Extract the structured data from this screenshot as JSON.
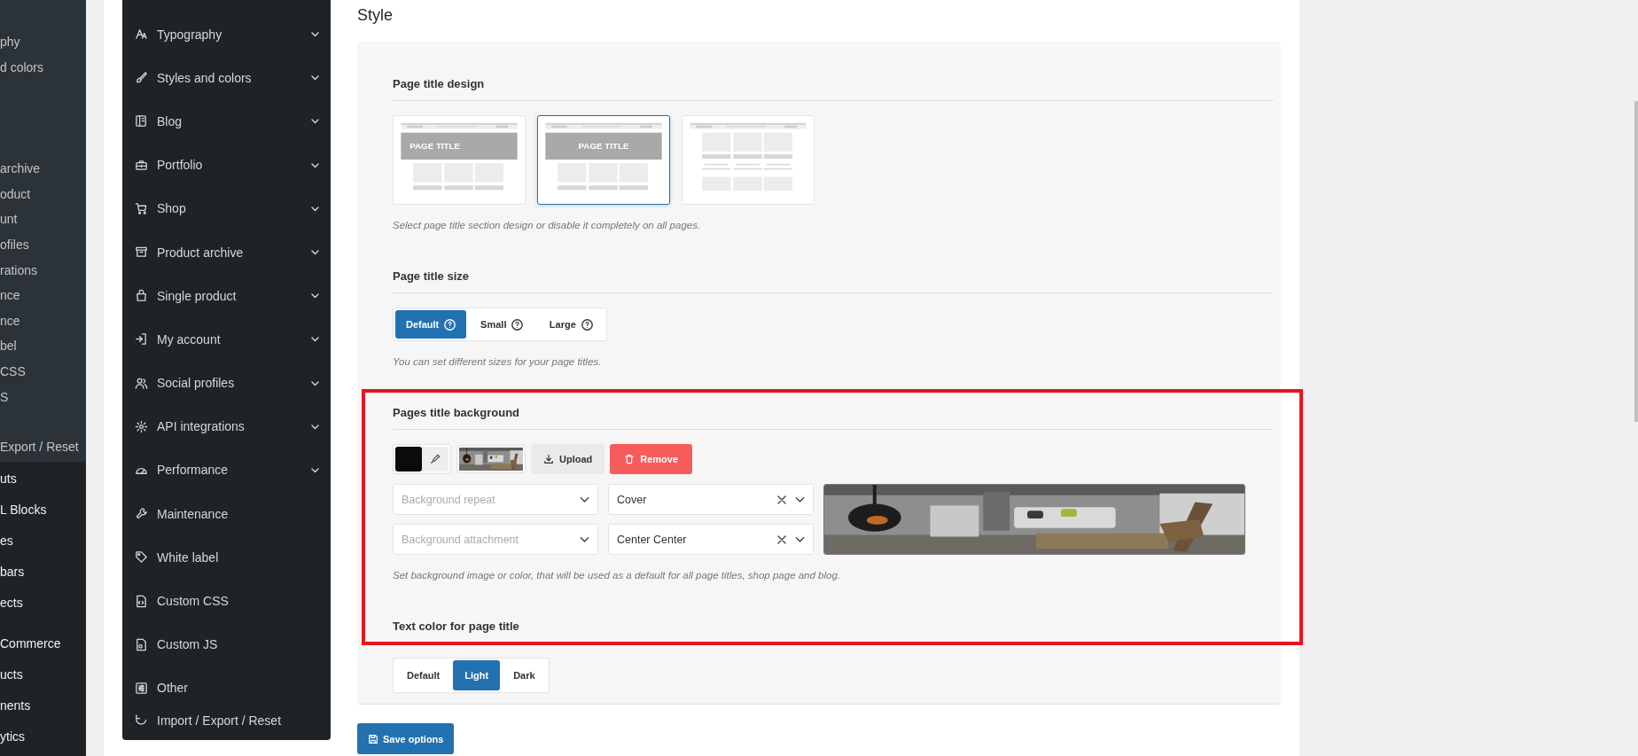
{
  "admin_menu": {
    "upper_items": [
      {
        "label": "phy"
      },
      {
        "label": "d colors"
      },
      {
        "label": "archive"
      },
      {
        "label": "oduct"
      },
      {
        "label": "unt"
      },
      {
        "label": "ofiles"
      },
      {
        "label": "rations"
      },
      {
        "label": "nce"
      },
      {
        "label": "nce"
      },
      {
        "label": "bel"
      },
      {
        "label": "CSS"
      },
      {
        "label": "S"
      },
      {
        "label": "Export / Reset"
      }
    ],
    "lower_items": [
      {
        "label": "uts"
      },
      {
        "label": "L Blocks"
      },
      {
        "label": "es"
      },
      {
        "label": "bars"
      },
      {
        "label": "ects"
      },
      {
        "label": "Commerce"
      },
      {
        "label": "ucts"
      },
      {
        "label": "nents"
      },
      {
        "label": "ytics"
      }
    ]
  },
  "options_menu": {
    "items": [
      {
        "label": "Typography",
        "expandable": true
      },
      {
        "label": "Styles and colors",
        "expandable": true
      },
      {
        "label": "Blog",
        "expandable": true
      },
      {
        "label": "Portfolio",
        "expandable": true
      },
      {
        "label": "Shop",
        "expandable": true
      },
      {
        "label": "Product archive",
        "expandable": true
      },
      {
        "label": "Single product",
        "expandable": true
      },
      {
        "label": "My account",
        "expandable": true
      },
      {
        "label": "Social profiles",
        "expandable": true
      },
      {
        "label": "API integrations",
        "expandable": true
      },
      {
        "label": "Performance",
        "expandable": true
      },
      {
        "label": "Maintenance",
        "expandable": false
      },
      {
        "label": "White label",
        "expandable": false
      },
      {
        "label": "Custom CSS",
        "expandable": false
      },
      {
        "label": "Custom JS",
        "expandable": false
      },
      {
        "label": "Other",
        "expandable": false
      },
      {
        "label": "Import / Export / Reset",
        "expandable": false
      }
    ]
  },
  "page": {
    "title": "Style",
    "sections": [
      {
        "kind": "thumbs",
        "heading": "Page title design",
        "hint": "Select page title section design or disable it completely on all pages.",
        "options": [
          {
            "kind": "left",
            "label": "PAGE TITLE",
            "selected": false
          },
          {
            "kind": "center",
            "label": "PAGE TITLE",
            "selected": true
          },
          {
            "kind": "none",
            "selected": false
          }
        ]
      },
      {
        "kind": "segmented",
        "heading": "Page title size",
        "hint": "You can set different sizes for your page titles.",
        "options": [
          {
            "label": "Default",
            "selected": true,
            "help": true
          },
          {
            "label": "Small",
            "selected": false,
            "help": true
          },
          {
            "label": "Large",
            "selected": false,
            "help": true
          }
        ]
      },
      {
        "kind": "background",
        "heading": "Pages title background",
        "hint": "Set background image or color, that will be used as a default for all page titles, shop page and blog.",
        "color": "#0b0b0b",
        "buttons": [
          {
            "kind": "upload",
            "label": "Upload"
          },
          {
            "kind": "remove",
            "label": "Remove"
          }
        ],
        "selects": [
          {
            "placeholder": "Background repeat"
          },
          {
            "value": "Cover",
            "clearable": true
          },
          {
            "placeholder": "Background attachment"
          },
          {
            "value": "Center Center",
            "clearable": true
          }
        ]
      },
      {
        "kind": "segmented",
        "heading": "Text color for page title",
        "options": [
          {
            "label": "Default",
            "selected": false,
            "help": false
          },
          {
            "label": "Light",
            "selected": true,
            "help": false
          },
          {
            "label": "Dark",
            "selected": false,
            "help": false
          }
        ]
      }
    ],
    "save_button": "Save options"
  }
}
